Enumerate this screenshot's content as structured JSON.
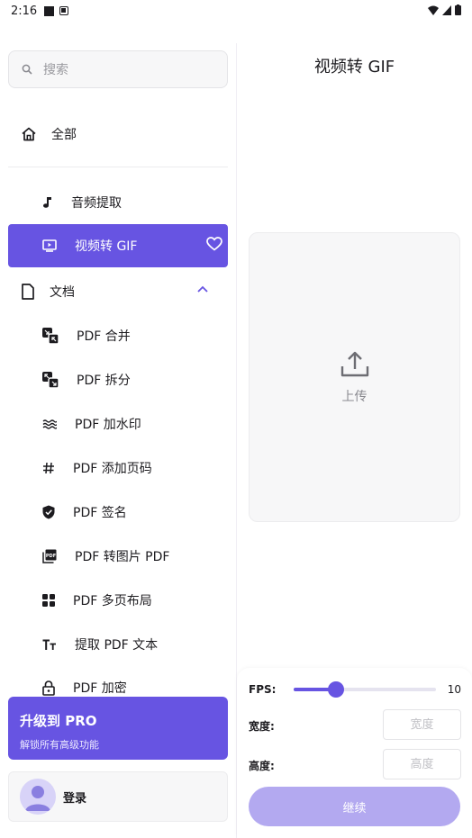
{
  "status_bar": {
    "time": "2:16"
  },
  "sidebar": {
    "search_placeholder": "搜索",
    "home_label": "全部",
    "items": [
      {
        "label": "音频提取",
        "icon": "music-note-icon",
        "active": false
      },
      {
        "label": "视频转 GIF",
        "icon": "play-screen-icon",
        "active": true
      }
    ],
    "group": {
      "label": "文档",
      "icon": "document-icon",
      "expanded": true
    },
    "doc_items": [
      {
        "label": "PDF 合并",
        "icon": "merge-icon"
      },
      {
        "label": "PDF 拆分",
        "icon": "split-icon"
      },
      {
        "label": "PDF 加水印",
        "icon": "watermark-icon"
      },
      {
        "label": "PDF 添加页码",
        "icon": "hash-icon"
      },
      {
        "label": "PDF 签名",
        "icon": "shield-check-icon"
      },
      {
        "label": "PDF 转图片 PDF",
        "icon": "pdf-image-icon"
      },
      {
        "label": "PDF 多页布局",
        "icon": "grid-icon"
      },
      {
        "label": "提取 PDF 文本",
        "icon": "text-icon"
      },
      {
        "label": "PDF 加密",
        "icon": "lock-icon"
      }
    ],
    "pro": {
      "title": "升级到 PRO",
      "subtitle": "解锁所有高级功能"
    },
    "login_label": "登录"
  },
  "main": {
    "title": "视频转 GIF",
    "upload_label": "上传",
    "fps": {
      "label": "FPS:",
      "value": "10",
      "fraction": 0.3
    },
    "width": {
      "label": "宽度:",
      "placeholder": "宽度"
    },
    "height": {
      "label": "高度:",
      "placeholder": "高度"
    },
    "continue_label": "继续"
  },
  "colors": {
    "accent": "#6754e2",
    "button_disabled": "#b3a9f0"
  }
}
